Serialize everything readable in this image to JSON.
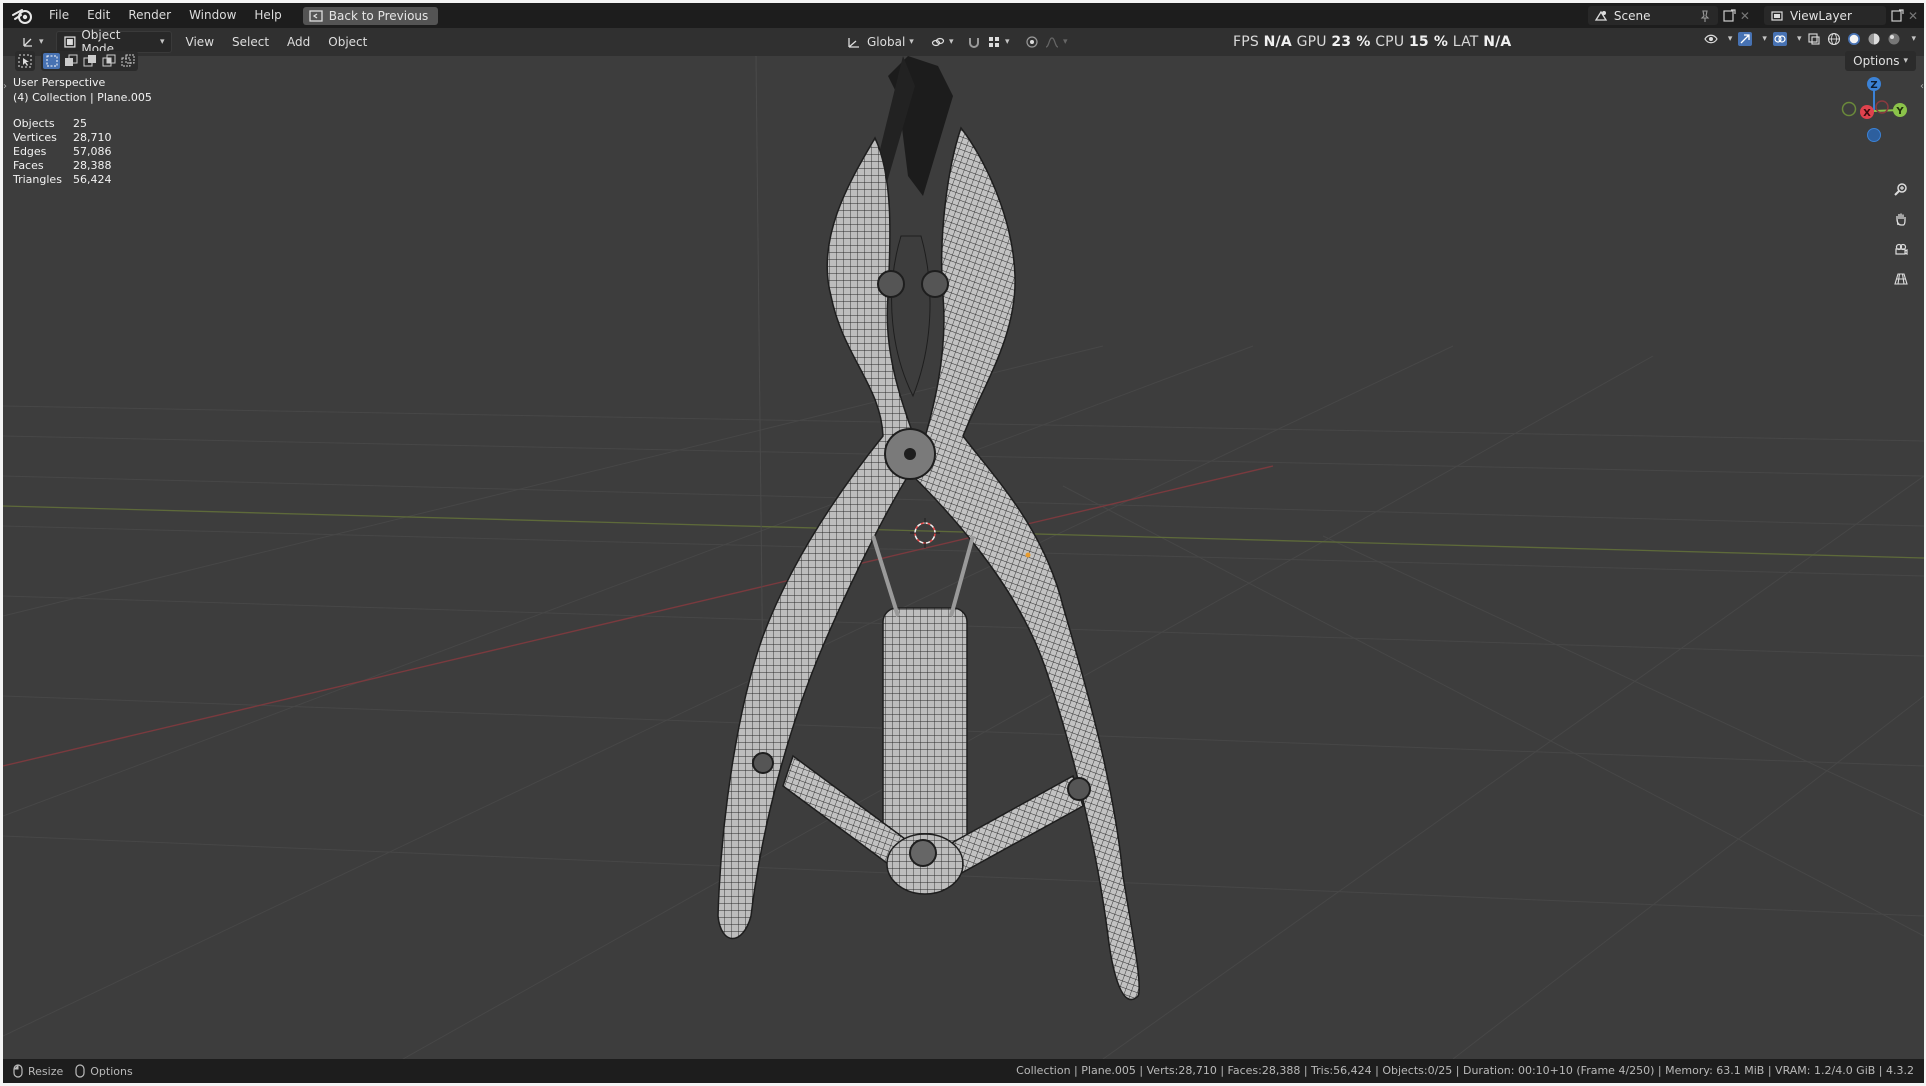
{
  "menu": {
    "items": [
      "File",
      "Edit",
      "Render",
      "Window",
      "Help"
    ],
    "back_button": "Back to Previous"
  },
  "scene": {
    "scene_name": "Scene",
    "view_layer": "ViewLayer"
  },
  "header": {
    "mode": "Object Mode",
    "menus": [
      "View",
      "Select",
      "Add",
      "Object"
    ],
    "orientation": "Global",
    "options": "Options"
  },
  "perf": {
    "fps_label": "FPS",
    "fps": "N/A",
    "gpu_label": "GPU",
    "gpu": "23 %",
    "cpu_label": "CPU",
    "cpu": "15 %",
    "lat_label": "LAT",
    "lat": "N/A"
  },
  "overlay": {
    "view_name": "User Perspective",
    "collection_info": "(4) Collection | Plane.005",
    "stats": [
      {
        "label": "Objects",
        "value": "25"
      },
      {
        "label": "Vertices",
        "value": "28,710"
      },
      {
        "label": "Edges",
        "value": "57,086"
      },
      {
        "label": "Faces",
        "value": "28,388"
      },
      {
        "label": "Triangles",
        "value": "56,424"
      }
    ]
  },
  "gizmo": {
    "z": "Z",
    "x": "X",
    "y": "Y"
  },
  "status": {
    "left_1": "Resize",
    "left_2": "Options",
    "right": "Collection | Plane.005 | Verts:28,710 | Faces:28,388 | Tris:56,424 | Objects:0/25 | Duration: 00:10+10 (Frame 4/250) | Memory: 63.1 MiB | VRAM: 1.2/4.0 GiB | 4.3.2"
  },
  "colors": {
    "accent": "#4772b3",
    "x_axis": "#e0424d",
    "y_axis": "#8bc34a",
    "z_axis": "#3b82d6"
  }
}
